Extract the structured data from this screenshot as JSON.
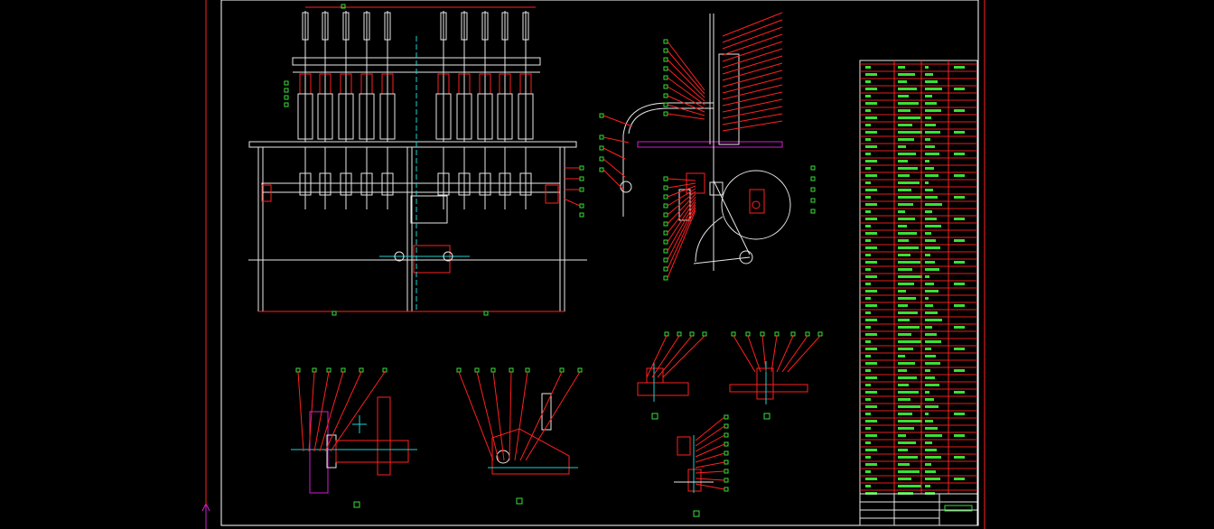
{
  "drawing": {
    "background_color": "#000000",
    "line_colors": {
      "outline": "#e8e8e8",
      "leader": "#ff2020",
      "centerline": "#20d0d0",
      "annotation": "#38e038",
      "hatch": "#d020d0",
      "accent": "#e0e020"
    },
    "views": [
      {
        "name": "front-elevation-view"
      },
      {
        "name": "side-section-view"
      },
      {
        "name": "detail-view-1"
      },
      {
        "name": "detail-view-2"
      },
      {
        "name": "detail-view-3"
      },
      {
        "name": "detail-view-4"
      },
      {
        "name": "detail-view-5"
      }
    ],
    "parts_list_panel": {
      "name": "bill-of-materials"
    },
    "title_block": {
      "name": "title-block"
    },
    "ucs_icon": "ucs-axis-icon"
  }
}
